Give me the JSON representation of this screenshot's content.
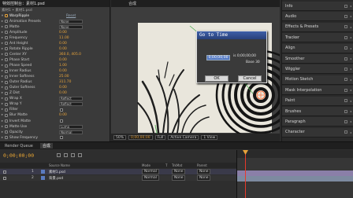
{
  "effect_controls": {
    "tab_title": "特效控制台：素材1.psd",
    "header": "素材1 • 素材1.psd",
    "effect_name": "WarpRipple",
    "reset_label": "Reset",
    "rows": [
      {
        "label": "Animation Presets",
        "value": "None",
        "type": "drop"
      },
      {
        "label": "Matte",
        "value": "None",
        "type": "drop"
      },
      {
        "label": "Amplitude",
        "value": "0.00",
        "type": "val"
      },
      {
        "label": "Frequency",
        "value": "11.00",
        "type": "val"
      },
      {
        "label": "Ant Height",
        "value": "0.00",
        "type": "val"
      },
      {
        "label": "Rotate Ripple",
        "value": "0.00",
        "type": "val"
      },
      {
        "label": "Center XY",
        "value": "360.0, 405.0",
        "type": "val"
      },
      {
        "label": "Phase Start",
        "value": "0.00",
        "type": "val"
      },
      {
        "label": "Phase Speed",
        "value": "1.00",
        "type": "val"
      },
      {
        "label": "Inner Radius",
        "value": "0.00",
        "type": "val"
      },
      {
        "label": "Inner Softness",
        "value": "25.00",
        "type": "val"
      },
      {
        "label": "Outer Radius",
        "value": "311.70",
        "type": "val"
      },
      {
        "label": "Outer Softness",
        "value": "0.00",
        "type": "val"
      },
      {
        "label": "Z Dist",
        "value": "0.00",
        "type": "val"
      },
      {
        "label": "Wrap X",
        "value": "Reflect",
        "type": "drop"
      },
      {
        "label": "Wrap Y",
        "value": "Reflect",
        "type": "drop"
      },
      {
        "label": "Filter",
        "value": "",
        "type": "check"
      },
      {
        "label": "Blur Matte",
        "value": "0.00",
        "type": "val"
      },
      {
        "label": "Invert Matte",
        "value": "",
        "type": "check"
      },
      {
        "label": "Matte Use",
        "value": "Luma",
        "type": "drop"
      },
      {
        "label": "Opacity",
        "value": "Normal",
        "type": "drop"
      },
      {
        "label": "Show Frequency",
        "value": "",
        "type": "check"
      }
    ]
  },
  "composition": {
    "tab_title": "合成",
    "zoom": "50%",
    "timecode": "0;00;00;00",
    "quality": "Full",
    "view": "Active Camera",
    "views": "1 View"
  },
  "dialog": {
    "title": "Go to Time",
    "time_value": "0;00;00;00",
    "equals_text": "is 0;00;00;00",
    "base_text": "Base 30",
    "ok_label": "OK",
    "cancel_label": "Cancel"
  },
  "right_panels": [
    "Info",
    "Audio",
    "Effects & Presets",
    "Tracker",
    "Align",
    "Smoother",
    "Wiggler",
    "Motion Sketch",
    "Mask Interpolation",
    "Paint",
    "Brushes",
    "Paragraph",
    "Character"
  ],
  "timeline": {
    "tabs": [
      "Render Queue",
      "合成"
    ],
    "current_time": "0;00;00;00",
    "columns": [
      "Source Name",
      "Mode",
      "T",
      "TrkMat",
      "Parent"
    ],
    "layers": [
      {
        "index": "1",
        "name": "素材1.psd",
        "mode": "Normal",
        "trkmat": "None",
        "parent": "None"
      },
      {
        "index": "2",
        "name": "背景.psd",
        "mode": "Normal",
        "trkmat": "None",
        "parent": "None"
      }
    ]
  },
  "colors": {
    "accent_orange": "#e6a23a",
    "dialog_title_blue": "#3d5fa8",
    "playhead_red": "#e63a2a"
  }
}
